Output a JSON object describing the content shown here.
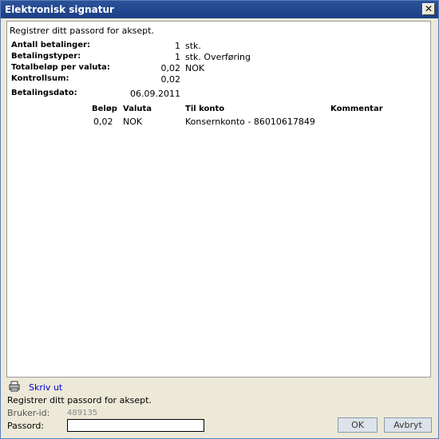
{
  "window": {
    "title": "Elektronisk signatur",
    "close_glyph": "✕"
  },
  "prompt_top": "Registrer ditt passord for aksept.",
  "summary": {
    "payments_label": "Antall betalinger:",
    "payments_value": "1",
    "payments_unit": "stk.",
    "types_label": "Betalingstyper:",
    "types_value": "1",
    "types_unit": "stk. Overføring",
    "total_label": "Totalbeløp per valuta:",
    "total_value": "0,02",
    "total_unit": "NOK",
    "checksum_label": "Kontrollsum:",
    "checksum_value": "0,02",
    "date_label": "Betalingsdato:",
    "date_value": "06.09.2011"
  },
  "table": {
    "headers": {
      "amount": "Beløp",
      "currency": "Valuta",
      "to_account": "Til konto",
      "comment": "Kommentar"
    },
    "rows": [
      {
        "amount": "0,02",
        "currency": "NOK",
        "to_account": "Konsernkonto - 86010617849",
        "comment": ""
      }
    ]
  },
  "footer": {
    "print_icon": "printer-icon",
    "print_link": "Skriv ut",
    "prompt": "Registrer ditt passord for aksept.",
    "userid_label": "Bruker-id:",
    "userid_value": "489135",
    "password_label": "Passord:",
    "password_value": "",
    "ok_label": "OK",
    "cancel_label": "Avbryt"
  },
  "colors": {
    "titlebar": "#1c3f86",
    "link": "#0000cc",
    "button_face": "#dde3ea",
    "dialog_bg": "#ece9d8"
  }
}
